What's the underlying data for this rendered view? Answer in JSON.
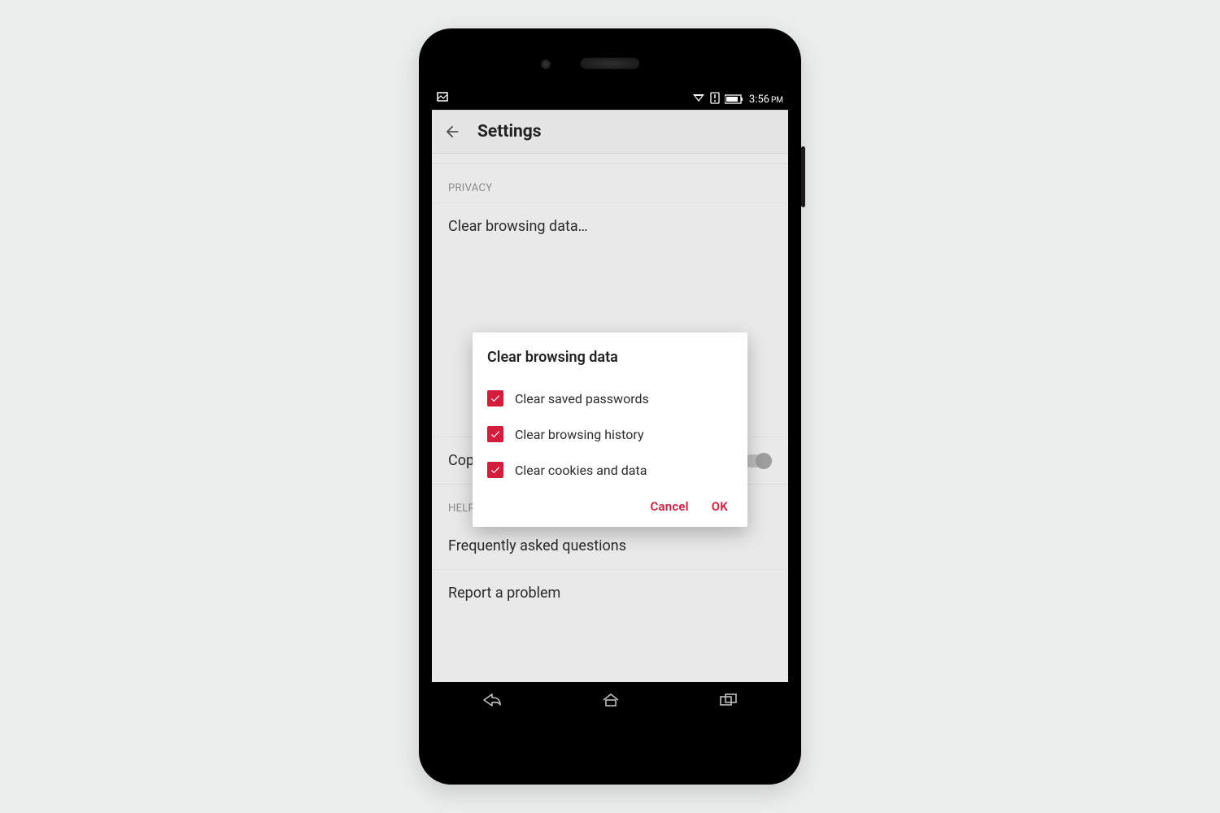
{
  "statusbar": {
    "time": "3:56",
    "time_suffix": "PM"
  },
  "appbar": {
    "title": "Settings"
  },
  "sections": {
    "privacy_header": "PRIVACY",
    "help_header": "HELP"
  },
  "items": {
    "clear_browsing_data": "Clear browsing data…",
    "copy_and_search": "Copy and search",
    "faq": "Frequently asked questions",
    "report_problem": "Report a problem"
  },
  "dialog": {
    "title": "Clear browsing data",
    "options": [
      {
        "label": "Clear saved passwords",
        "checked": true
      },
      {
        "label": "Clear browsing history",
        "checked": true
      },
      {
        "label": "Clear cookies and data",
        "checked": true
      }
    ],
    "cancel_label": "Cancel",
    "ok_label": "OK"
  },
  "colors": {
    "accent": "#d41c3d"
  }
}
